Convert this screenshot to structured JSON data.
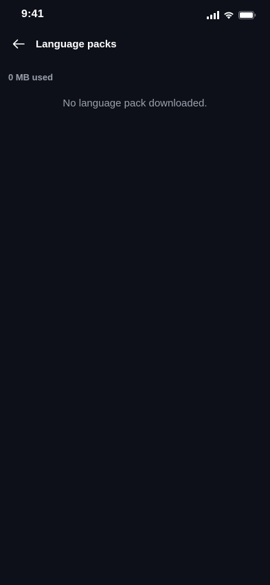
{
  "status_bar": {
    "time": "9:41",
    "icons": [
      "cellular-signal-icon",
      "wifi-icon",
      "battery-icon"
    ]
  },
  "header": {
    "back_icon": "arrow-left-icon",
    "title": "Language packs"
  },
  "storage": {
    "used_label": "0 MB used"
  },
  "empty_state": {
    "message": "No language pack downloaded."
  },
  "colors": {
    "background": "#0d1018",
    "primary_text": "#ffffff",
    "secondary_text": "#9aa0ab"
  }
}
